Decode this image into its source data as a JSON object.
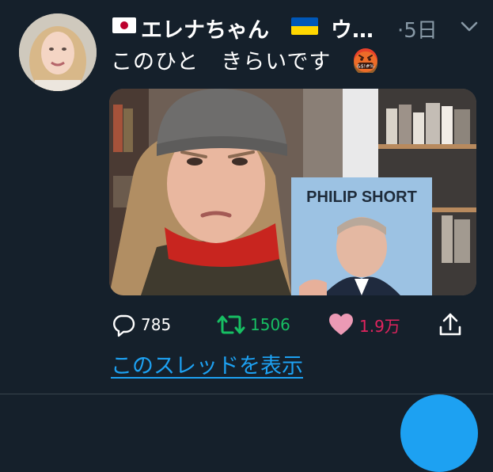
{
  "tweet": {
    "display_name": "エレナちゃん",
    "name_truncation": "ウ…",
    "time": "·5日",
    "text": "このひと　きらいです",
    "media": {
      "book_author": "PHILIP SHORT"
    }
  },
  "actions": {
    "reply_count": "785",
    "retweet_count": "1506",
    "like_count": "1.9万"
  },
  "thread_link": "このスレッドを表示",
  "icons": {
    "flag_left": "japan-flag-icon",
    "flag_right": "ukraine-flag-icon",
    "emoji": "face-with-symbols-on-mouth-icon",
    "menu": "chevron-down-icon",
    "reply": "reply-icon",
    "retweet": "retweet-icon",
    "like": "heart-icon",
    "share": "share-icon"
  },
  "colors": {
    "background": "#15202b",
    "secondary_text": "#8899a6",
    "link": "#1da1f2",
    "retweet": "#17bf63",
    "like": "#e0245e",
    "jp_red": "#bc002d",
    "ua_blue": "#0057b7",
    "ua_yellow": "#ffd700"
  }
}
